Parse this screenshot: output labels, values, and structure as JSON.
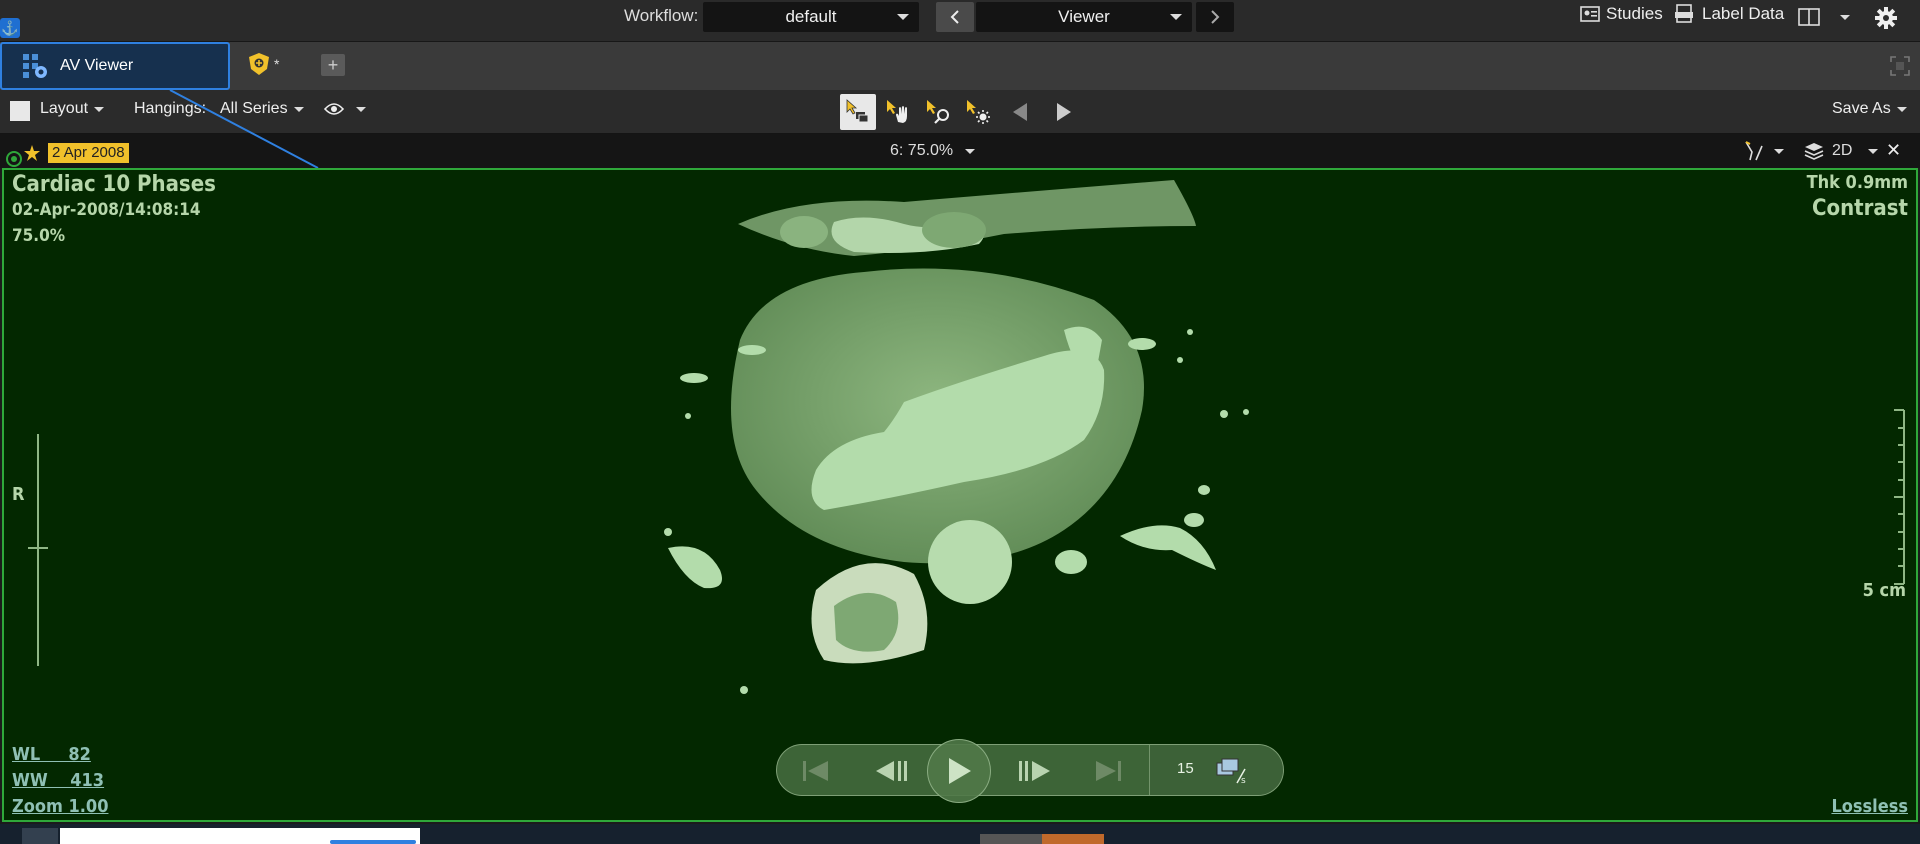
{
  "topbar": {
    "workflow_label": "Workflow:",
    "workflow_value": "default",
    "viewer_value": "Viewer",
    "studies_label": "Studies",
    "label_data_label": "Label Data"
  },
  "tabs": {
    "active_label": "AV Viewer",
    "second_suffix": "*"
  },
  "toolbar": {
    "layout_label": "Layout",
    "hangings_label": "Hangings:",
    "hangings_value": "All Series",
    "save_as_label": "Save As"
  },
  "viewport_header": {
    "date": "2 Apr 2008",
    "zoom_info": "6: 75.0%",
    "mode": "2D"
  },
  "overlay": {
    "series_title": "Cardiac 10 Phases",
    "datetime": "02-Apr-2008/14:08:14",
    "zoom_pct": "75.0%",
    "thickness": "Thk 0.9mm",
    "contrast": "Contrast",
    "orientation": "R",
    "scale_label": "5 cm",
    "wl": "WL     82",
    "ww": "WW    413",
    "zoom": "Zoom 1.00",
    "compression": "Lossless"
  },
  "cine": {
    "fps": "15"
  },
  "colors": {
    "accent_blue": "#2f80e0",
    "viewport_border": "#2fa83a",
    "date_tag": "#f1c12b"
  }
}
